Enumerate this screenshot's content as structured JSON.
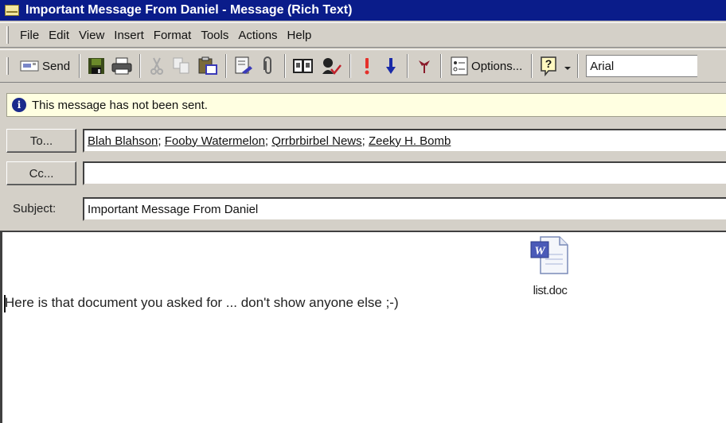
{
  "window": {
    "title": "Important Message From Daniel - Message (Rich Text)",
    "icon": "envelope-icon"
  },
  "menubar": {
    "items": [
      {
        "label": "File",
        "accel": "F"
      },
      {
        "label": "Edit",
        "accel": "E"
      },
      {
        "label": "View",
        "accel": "V"
      },
      {
        "label": "Insert",
        "accel": "I"
      },
      {
        "label": "Format",
        "accel": "o"
      },
      {
        "label": "Tools",
        "accel": "T"
      },
      {
        "label": "Actions",
        "accel": "A"
      },
      {
        "label": "Help",
        "accel": "H"
      }
    ]
  },
  "toolbar": {
    "send_label": "Send",
    "options_label": "Options...",
    "font_name": "Arial",
    "icons": [
      "send-icon",
      "save-icon",
      "print-icon",
      "cut-icon",
      "copy-icon",
      "paste-icon",
      "insert-file-icon",
      "attach-icon",
      "address-book-icon",
      "check-names-icon",
      "importance-high-icon",
      "importance-low-icon",
      "flag-icon",
      "options-icon",
      "help-icon",
      "dropdown-arrow-icon"
    ]
  },
  "infobar": {
    "icon": "info-icon",
    "text": "This message has not been sent."
  },
  "header": {
    "to_label": "To...",
    "cc_label": "Cc...",
    "subject_label": "Subject:",
    "to_recipients": [
      "Blah Blahson",
      "Fooby Watermelon",
      "Qrrbrbirbel News",
      "Zeeky H. Bomb"
    ],
    "cc_value": "",
    "subject_value": "Important Message From Daniel"
  },
  "body": {
    "text": "Here is that document you asked for ... don't show anyone else ;-)",
    "attachment": {
      "name": "list.doc",
      "icon": "word-document-icon"
    }
  }
}
